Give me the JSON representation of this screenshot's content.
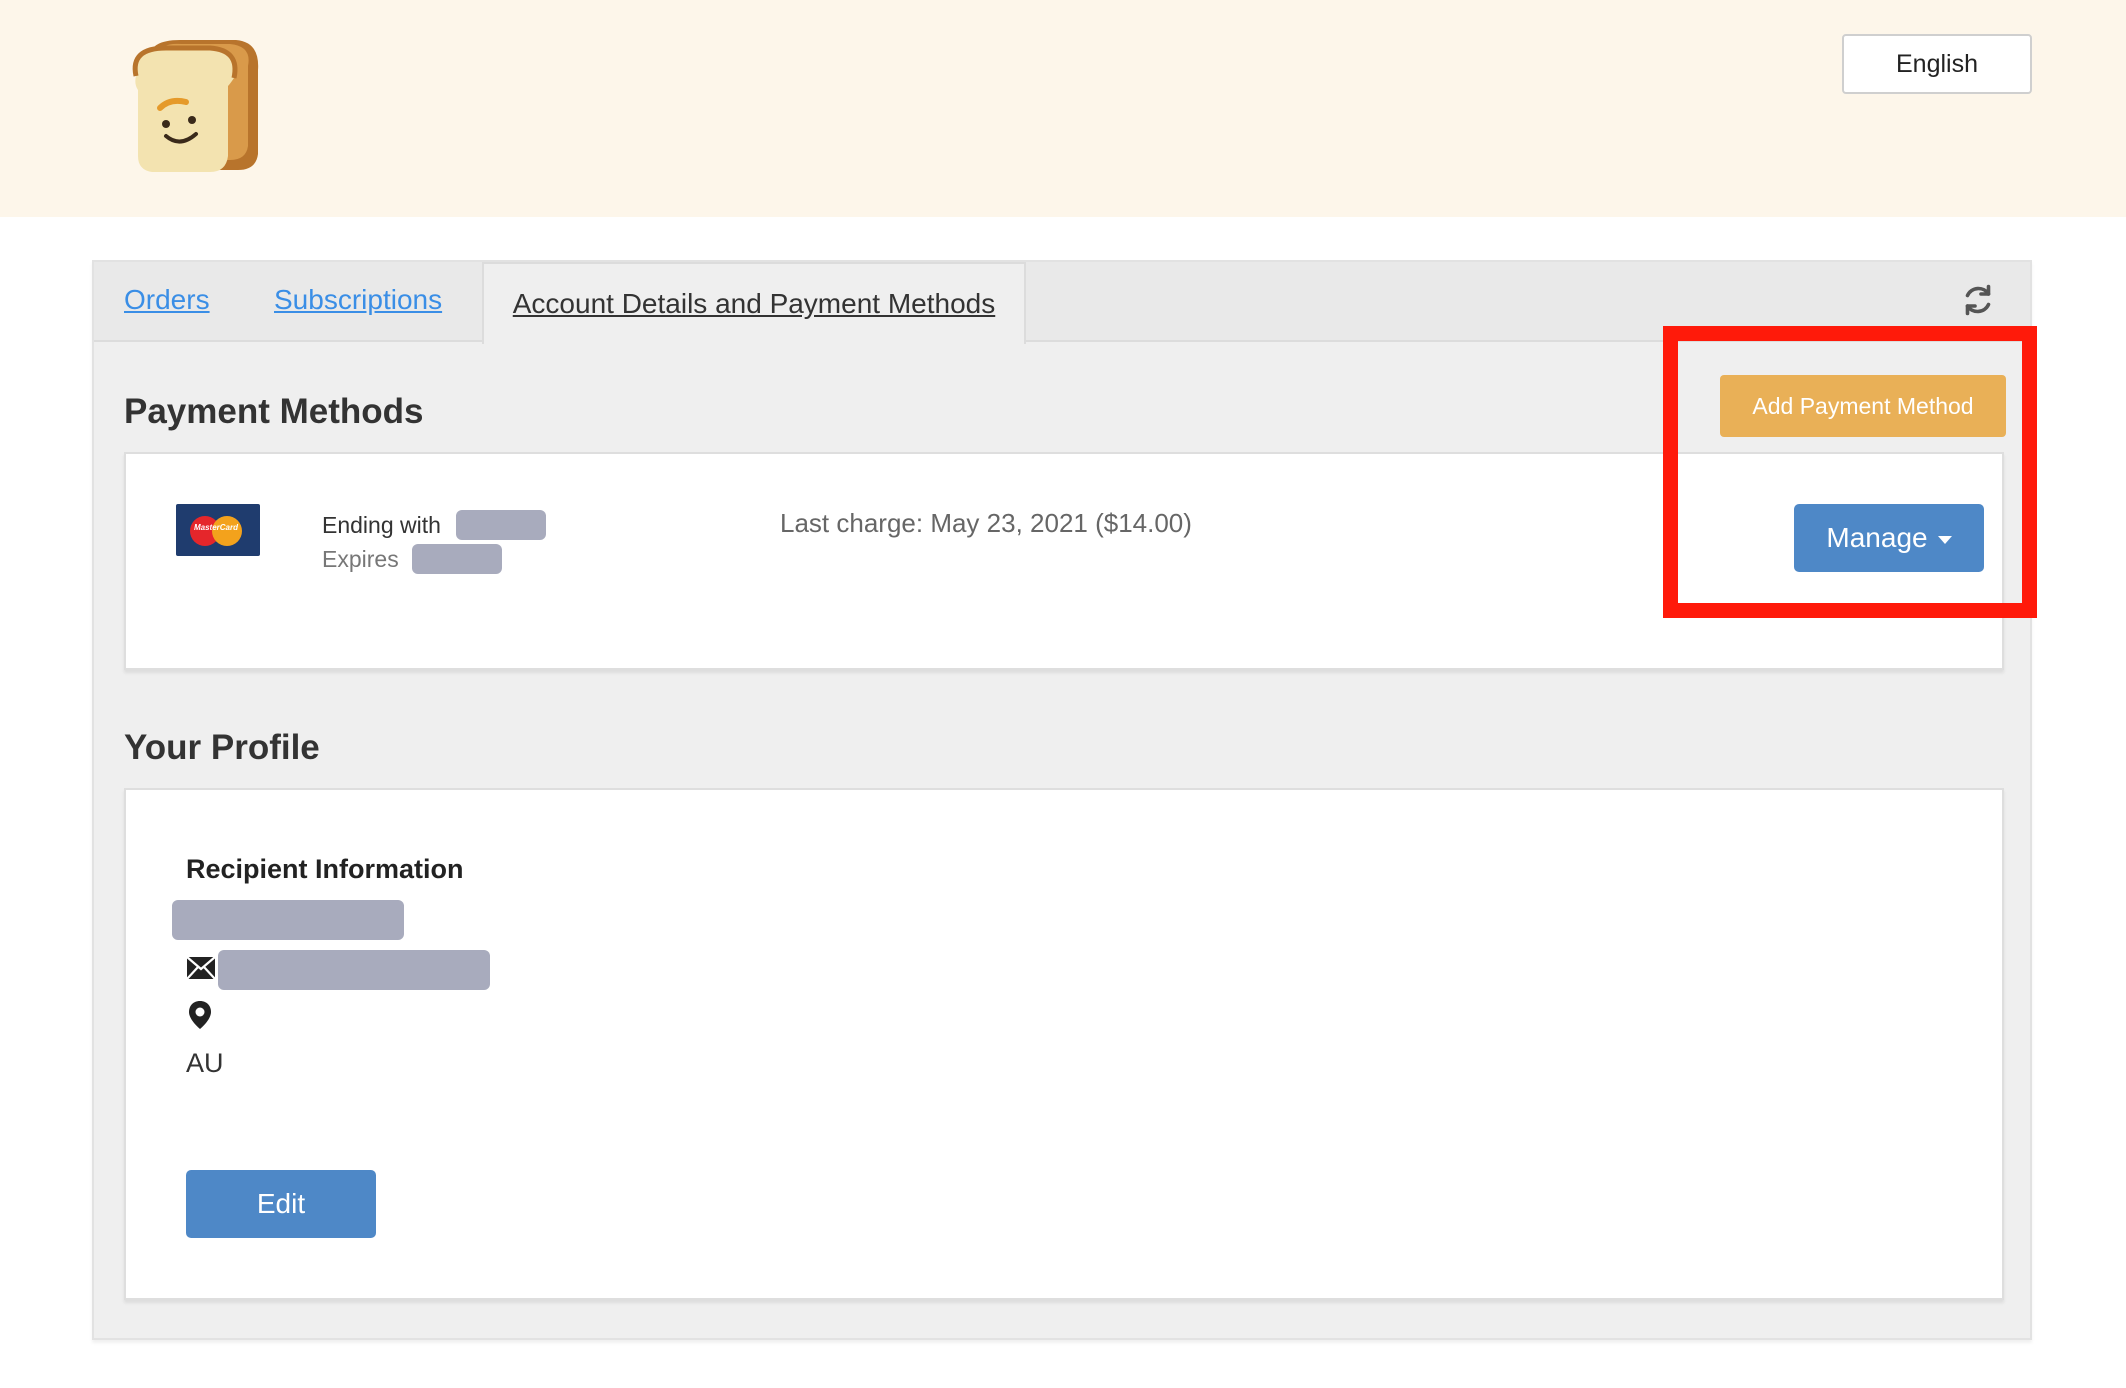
{
  "header": {
    "logo_icon": "toast-mascot-logo",
    "language_label": "English"
  },
  "tabs": [
    {
      "label": "Orders",
      "active": false
    },
    {
      "label": "Subscriptions",
      "active": false
    },
    {
      "label": "Account Details and Payment Methods",
      "active": true
    }
  ],
  "refresh_icon": "refresh-icon",
  "payment_methods": {
    "title": "Payment Methods",
    "add_button_label": "Add Payment Method",
    "card": {
      "brand_icon": "mastercard-icon",
      "brand_text": "MasterCard",
      "ending_label": "Ending with",
      "expires_label": "Expires",
      "last_charge": "Last charge: May 23, 2021 ($14.00)",
      "manage_label": "Manage"
    }
  },
  "profile": {
    "title": "Your Profile",
    "recipient_title": "Recipient Information",
    "country": "AU",
    "edit_label": "Edit"
  },
  "colors": {
    "header_bg": "#fdf6ea",
    "panel_bg": "#efefef",
    "link": "#3a8ee6",
    "primary_button": "#4e88c7",
    "warning_button": "#e9b057",
    "highlight_box": "#ff1a0a",
    "redaction": "#a8abbd"
  }
}
